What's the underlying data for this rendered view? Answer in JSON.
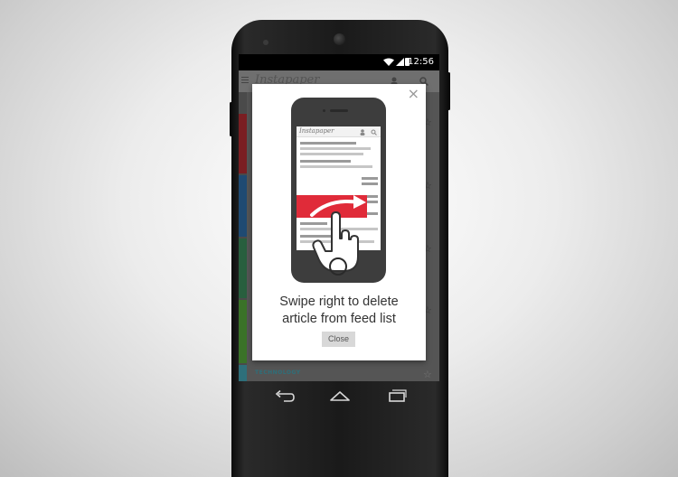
{
  "status_bar": {
    "time": "12:56"
  },
  "app": {
    "logo_text": "Instapaper",
    "feed_section_label": "TECHNOLOGY",
    "feed_colors": [
      "#8a1f24",
      "#1f4e7a",
      "#2e6b46",
      "#3d7a2a",
      "#6b7a2a",
      "#2e6f7a"
    ]
  },
  "modal": {
    "close_symbol": "×",
    "mini_logo": "Instapaper",
    "message_line1": "Swipe right to delete",
    "message_line2": "article from feed list",
    "close_button_label": "Close",
    "accent_color": "#e02b39"
  },
  "navbar": {
    "items": [
      "back",
      "home",
      "recent-apps"
    ]
  }
}
